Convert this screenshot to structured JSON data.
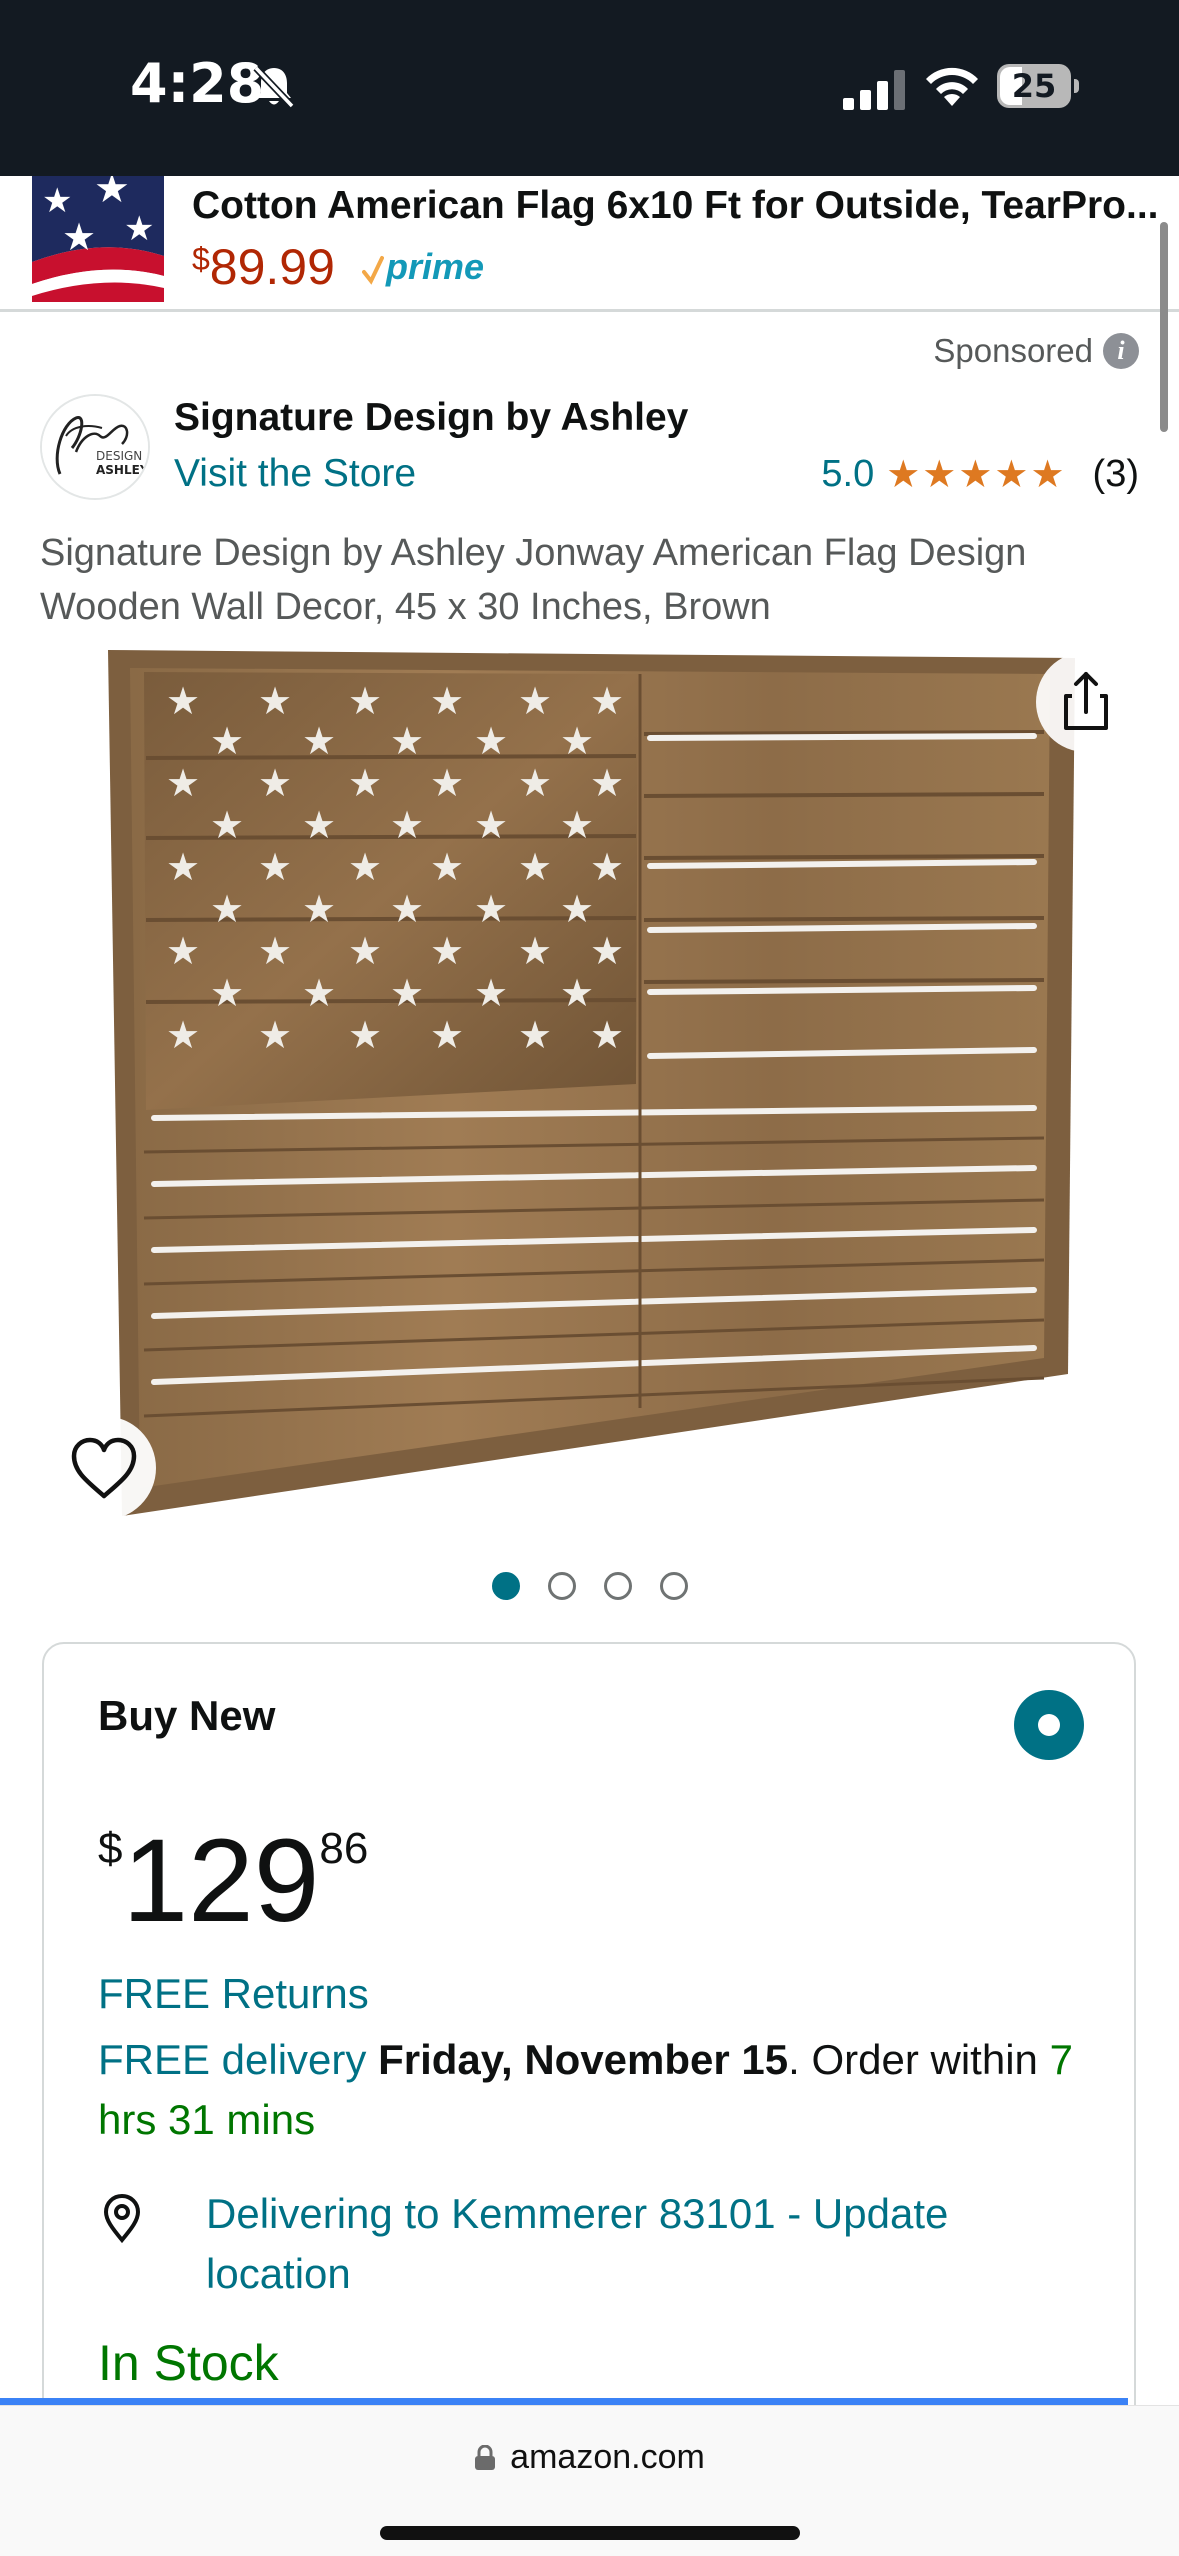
{
  "status_bar": {
    "time": "4:28",
    "battery": "25",
    "icons": [
      "bell-slash-icon",
      "signal-icon",
      "wifi-icon",
      "battery-icon"
    ]
  },
  "ad_banner": {
    "title": "Cotton American Flag 6x10 Ft for Outside, TearPro...",
    "price_symbol": "$",
    "price": "89.99",
    "prime_label": "prime"
  },
  "seller": {
    "sponsored_label": "Sponsored",
    "name": "Signature Design by Ashley",
    "visit_store": "Visit the Store",
    "rating": "5.0",
    "stars": "★★★★★",
    "review_count": "(3)",
    "logo_text": "Signature DESIGN ASHLEY"
  },
  "product": {
    "title": "Signature Design by Ashley Jonway American Flag Design Wooden Wall Decor, 45 x 30 Inches, Brown",
    "image_count": 4,
    "active_image": 1
  },
  "buy_box": {
    "heading": "Buy New",
    "price_symbol": "$",
    "price_whole": "129",
    "price_fraction": "86",
    "free_returns": "FREE Returns",
    "free_delivery": "FREE delivery",
    "delivery_date": "Friday, November 15",
    "order_suffix": ". Order within ",
    "countdown": "7 hrs 31 mins",
    "location": "Delivering to Kemmerer 83101 - Update location",
    "stock": "In Stock"
  },
  "browser": {
    "url": "amazon.com"
  },
  "colors": {
    "status_bar_bg": "#131a22",
    "link": "#007185",
    "price_red": "#b12704",
    "stock_green": "#007600",
    "star_orange": "#de7921",
    "prime_blue": "#1399b8"
  }
}
